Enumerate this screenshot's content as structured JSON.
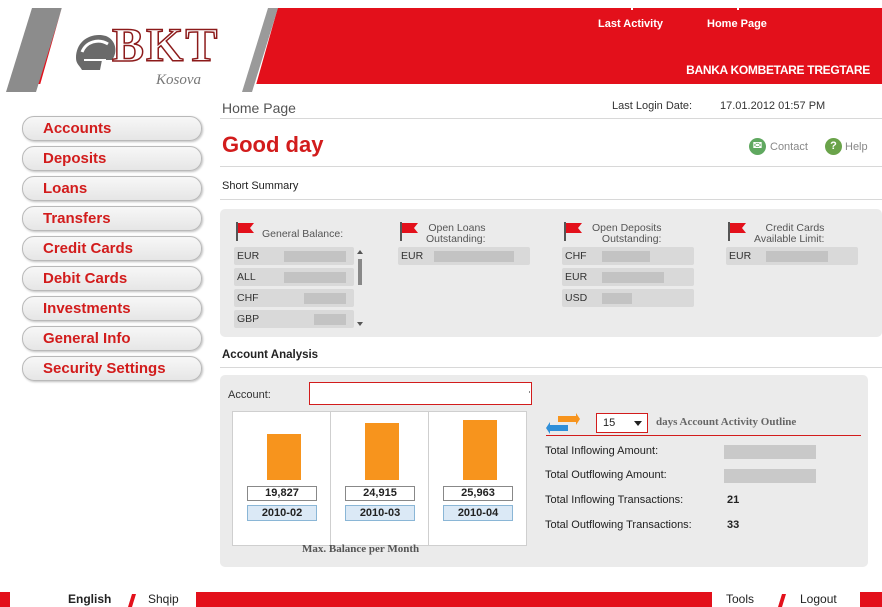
{
  "header": {
    "logo_text": "BKT",
    "logo_sub": "Kosova",
    "nav": [
      "Last Activity",
      "Home Page"
    ],
    "bank_name": "BANKA KOMBETARE TREGTARE"
  },
  "sidebar": {
    "items": [
      {
        "label": "Accounts"
      },
      {
        "label": "Deposits"
      },
      {
        "label": "Loans"
      },
      {
        "label": "Transfers"
      },
      {
        "label": "Credit Cards"
      },
      {
        "label": "Debit Cards"
      },
      {
        "label": "Investments"
      },
      {
        "label": "General Info"
      },
      {
        "label": "Security Settings"
      }
    ]
  },
  "main": {
    "breadcrumb": "Home Page",
    "last_login_label": "Last Login Date:",
    "last_login_value": "17.01.2012 01:57 PM",
    "greeting": "Good day",
    "contact_label": "Contact",
    "help_label": "Help",
    "short_summary": "Short Summary",
    "summary": {
      "general_balance": {
        "title": "General Balance:",
        "rows": [
          "EUR",
          "ALL",
          "CHF",
          "GBP"
        ]
      },
      "open_loans": {
        "title": [
          "Open Loans",
          "Outstanding:"
        ],
        "rows": [
          "EUR"
        ]
      },
      "open_deposits": {
        "title": [
          "Open Deposits",
          "Outstanding:"
        ],
        "rows": [
          "CHF",
          "EUR",
          "USD"
        ]
      },
      "credit_cards": {
        "title": [
          "Credit Cards",
          "Available Limit:"
        ],
        "rows": [
          "EUR"
        ]
      }
    },
    "account_analysis": "Account Analysis",
    "account_label": "Account:",
    "account_value": "",
    "days_value": "15",
    "days_text": "days Account Activity Outline",
    "stats": [
      {
        "label": "Total Inflowing Amount:",
        "value": ""
      },
      {
        "label": "Total Outflowing Amount:",
        "value": ""
      },
      {
        "label": "Total Inflowing Transactions:",
        "value": "21"
      },
      {
        "label": "Total Outflowing Transactions:",
        "value": "33"
      }
    ],
    "chart_caption": "Max. Balance per Month"
  },
  "chart_data": {
    "type": "bar",
    "categories": [
      "2010-02",
      "2010-03",
      "2010-04"
    ],
    "values": [
      19827,
      24915,
      25963
    ],
    "value_labels": [
      "19,827",
      "24,915",
      "25,963"
    ],
    "title": "Max. Balance per Month",
    "colors": {
      "bar": "#f7941d"
    }
  },
  "footer": {
    "lang_en": "English",
    "lang_sq": "Shqip",
    "tools": "Tools",
    "logout": "Logout"
  },
  "colors": {
    "brand_red": "#e3101b",
    "accent_orange": "#f7941d",
    "panel_gray": "#ebebeb"
  }
}
